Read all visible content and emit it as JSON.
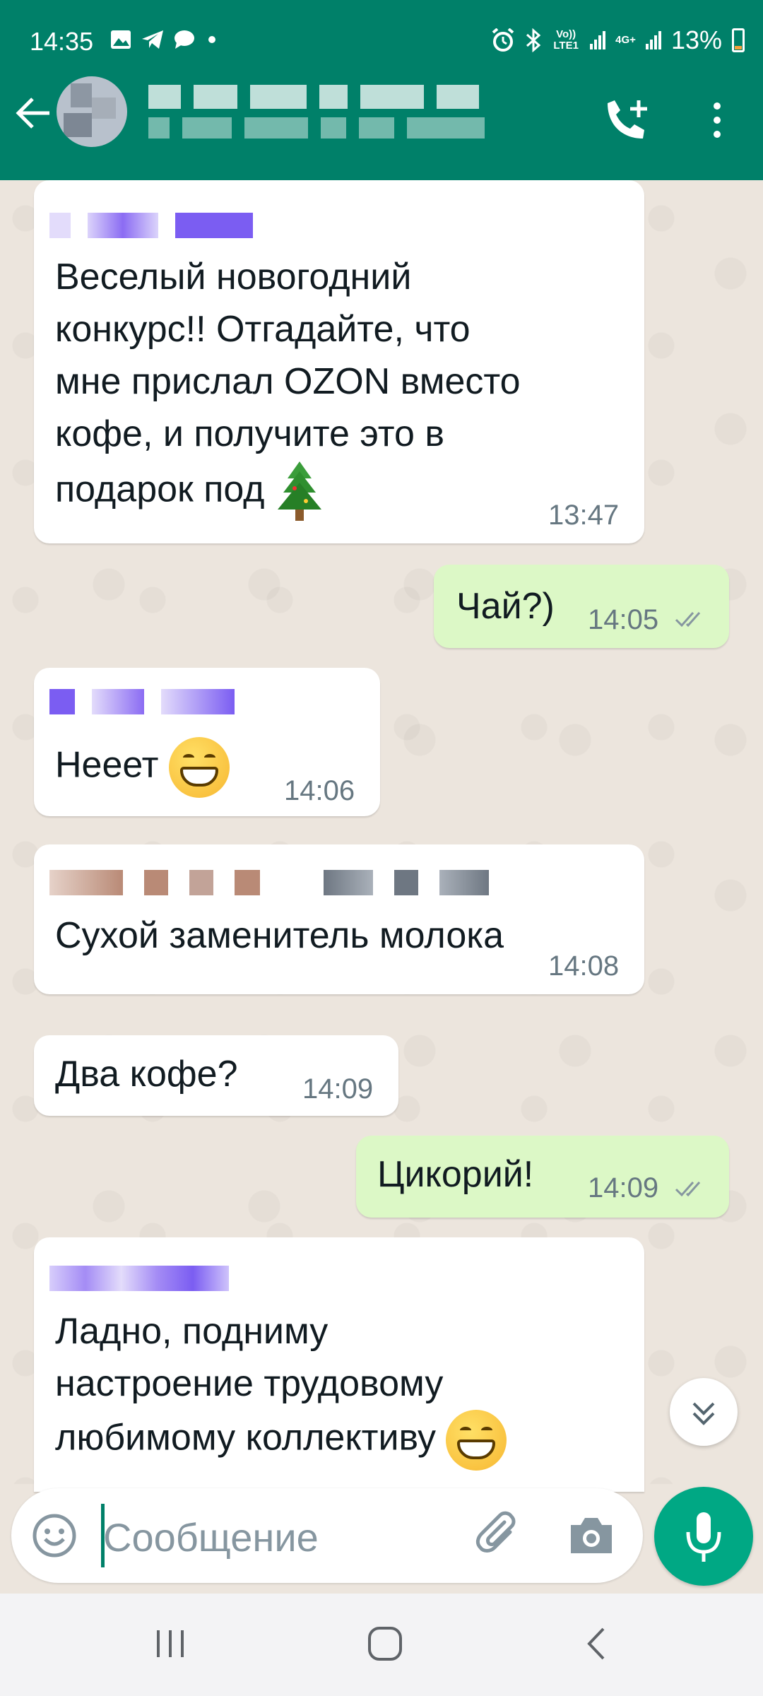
{
  "status_bar": {
    "time": "14:35",
    "network_1": "Vo)) LTE1",
    "network_2": "4G+",
    "battery": "13%",
    "icons": [
      "gallery-icon",
      "telegram-icon",
      "chat-bubble-icon",
      "dot-icon",
      "alarm-icon",
      "bluetooth-icon",
      "signal-icon",
      "battery-icon"
    ]
  },
  "toolbar": {
    "icons": [
      "back-arrow-icon",
      "add-call-icon",
      "more-vert-icon"
    ]
  },
  "messages": [
    {
      "direction": "in",
      "text_lines": [
        "Веселый новогодний",
        "конкурс!! Отгадайте, что",
        "мне прислал OZON вместо",
        "кофе, и получите это в",
        "подарок под"
      ],
      "emoji": "christmas-tree-icon",
      "time": "13:47"
    },
    {
      "direction": "out",
      "text": "Чай?)",
      "time": "14:05",
      "status": "read"
    },
    {
      "direction": "in",
      "text": "Нееет",
      "emoji": "grinning-face-icon",
      "time": "14:06"
    },
    {
      "direction": "in",
      "text": "Сухой заменитель молока",
      "time": "14:08"
    },
    {
      "direction": "in",
      "text": "Два кофе?",
      "time": "14:09"
    },
    {
      "direction": "out",
      "text": "Цикорий!",
      "time": "14:09",
      "status": "read"
    },
    {
      "direction": "in",
      "text_lines": [
        "Ладно, подниму",
        "настроение трудовому",
        "любимому коллективу"
      ],
      "emoji": "grinning-face-icon"
    }
  ],
  "composer": {
    "placeholder": "Сообщение",
    "icons": [
      "emoji-icon",
      "attach-icon",
      "camera-icon",
      "mic-icon"
    ]
  },
  "nav_bar": {
    "icons": [
      "recent-apps-icon",
      "home-icon",
      "back-icon"
    ]
  },
  "colors": {
    "header": "#008069",
    "incoming_bubble": "#ffffff",
    "outgoing_bubble": "#dcf8c6",
    "chat_background": "#ece5dd",
    "mic_button": "#00a884"
  }
}
